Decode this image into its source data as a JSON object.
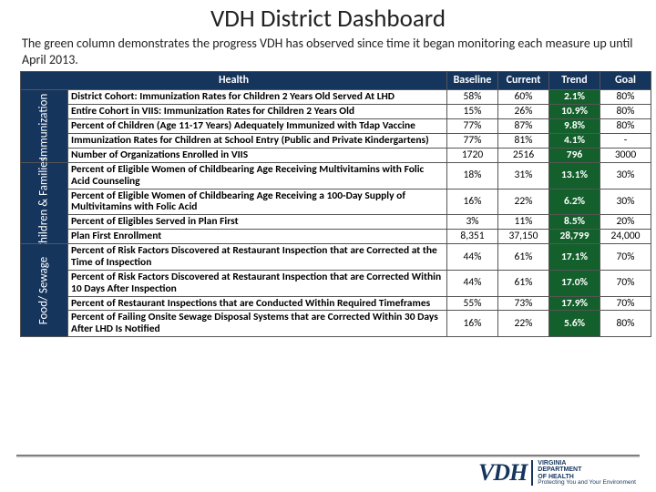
{
  "title": "VDH District Dashboard",
  "subtitle": "The green column demonstrates the progress VDH has observed since time it began monitoring each measure up until April 2013.",
  "headers": {
    "h1": "Health",
    "h2": "Baseline",
    "h3": "Current",
    "h4": "Trend",
    "h5": "Goal"
  },
  "sections": {
    "s1": "Immunization",
    "s2": "Children & Families",
    "s3": "Food/ Sewage"
  },
  "rows": {
    "r1": {
      "m": "District Cohort: Immunization Rates for Children 2 Years Old Served At LHD",
      "b": "58%",
      "c": "60%",
      "t": "2.1%",
      "g": "80%"
    },
    "r2": {
      "m": "Entire Cohort in VIIS: Immunization Rates for Children 2 Years Old",
      "b": "15%",
      "c": "26%",
      "t": "10.9%",
      "g": "80%"
    },
    "r3": {
      "m": "Percent of Children (Age 11-17 Years) Adequately Immunized with Tdap Vaccine",
      "b": "77%",
      "c": "87%",
      "t": "9.8%",
      "g": "80%"
    },
    "r4": {
      "m": "Immunization Rates for Children at School Entry (Public and Private Kindergartens)",
      "b": "77%",
      "c": "81%",
      "t": "4.1%",
      "g": "-"
    },
    "r5": {
      "m": "Number of Organizations Enrolled in VIIS",
      "b": "1720",
      "c": "2516",
      "t": "796",
      "g": "3000"
    },
    "r6": {
      "m": "Percent of Eligible Women of Childbearing Age Receiving Multivitamins with Folic Acid Counseling",
      "b": "18%",
      "c": "31%",
      "t": "13.1%",
      "g": "30%"
    },
    "r7": {
      "m": "Percent of Eligible Women of Childbearing Age Receiving a 100-Day Supply of Multivitamins with Folic Acid",
      "b": "16%",
      "c": "22%",
      "t": "6.2%",
      "g": "30%"
    },
    "r8": {
      "m": "Percent of Eligibles Served in Plan First",
      "b": "3%",
      "c": "11%",
      "t": "8.5%",
      "g": "20%"
    },
    "r9": {
      "m": "Plan First Enrollment",
      "b": "8,351",
      "c": "37,150",
      "t": "28,799",
      "g": "24,000"
    },
    "r10": {
      "m": "Percent of Risk Factors Discovered at Restaurant Inspection that are Corrected at the Time of Inspection",
      "b": "44%",
      "c": "61%",
      "t": "17.1%",
      "g": "70%"
    },
    "r11": {
      "m": "Percent of Risk Factors Discovered at Restaurant Inspection that are Corrected Within 10 Days After Inspection",
      "b": "44%",
      "c": "61%",
      "t": "17.0%",
      "g": "70%"
    },
    "r12": {
      "m": "Percent of Restaurant Inspections that are Conducted Within Required Timeframes",
      "b": "55%",
      "c": "73%",
      "t": "17.9%",
      "g": "70%"
    },
    "r13": {
      "m": "Percent of Failing Onsite Sewage Disposal Systems that are Corrected Within 30 Days After LHD Is Notified",
      "b": "16%",
      "c": "22%",
      "t": "5.6%",
      "g": "80%"
    }
  },
  "logo": {
    "brand": "VDH",
    "line1": "VIRGINIA",
    "line2": "DEPARTMENT",
    "line3": "OF HEALTH",
    "tagline": "Protecting You and Your Environment"
  }
}
